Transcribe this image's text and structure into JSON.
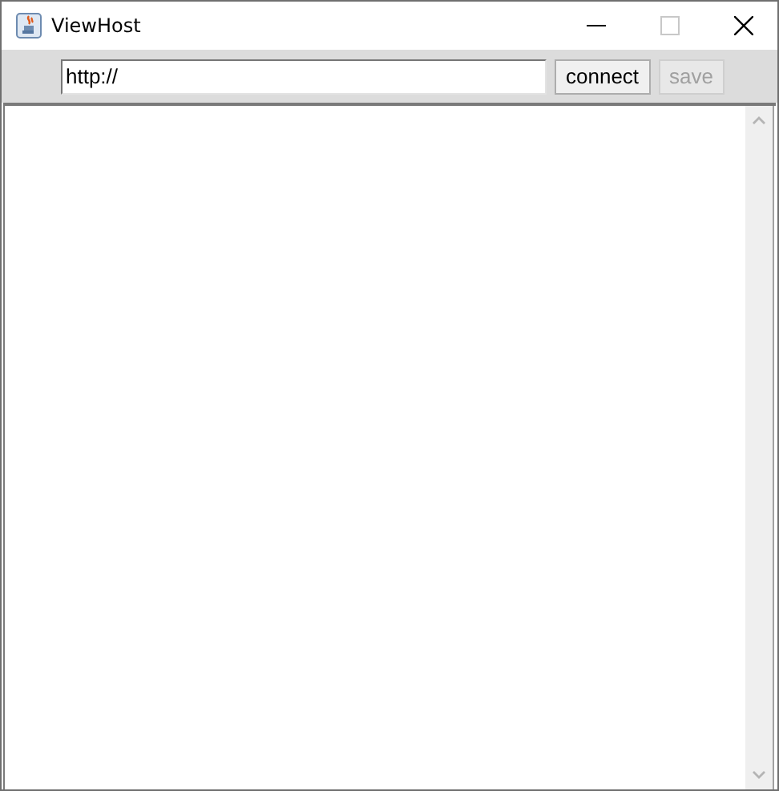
{
  "window": {
    "title": "ViewHost"
  },
  "url_field": {
    "value": "http://"
  },
  "buttons": [
    {
      "label": "connect",
      "disabled": false
    },
    {
      "label": "save",
      "disabled": true
    }
  ]
}
